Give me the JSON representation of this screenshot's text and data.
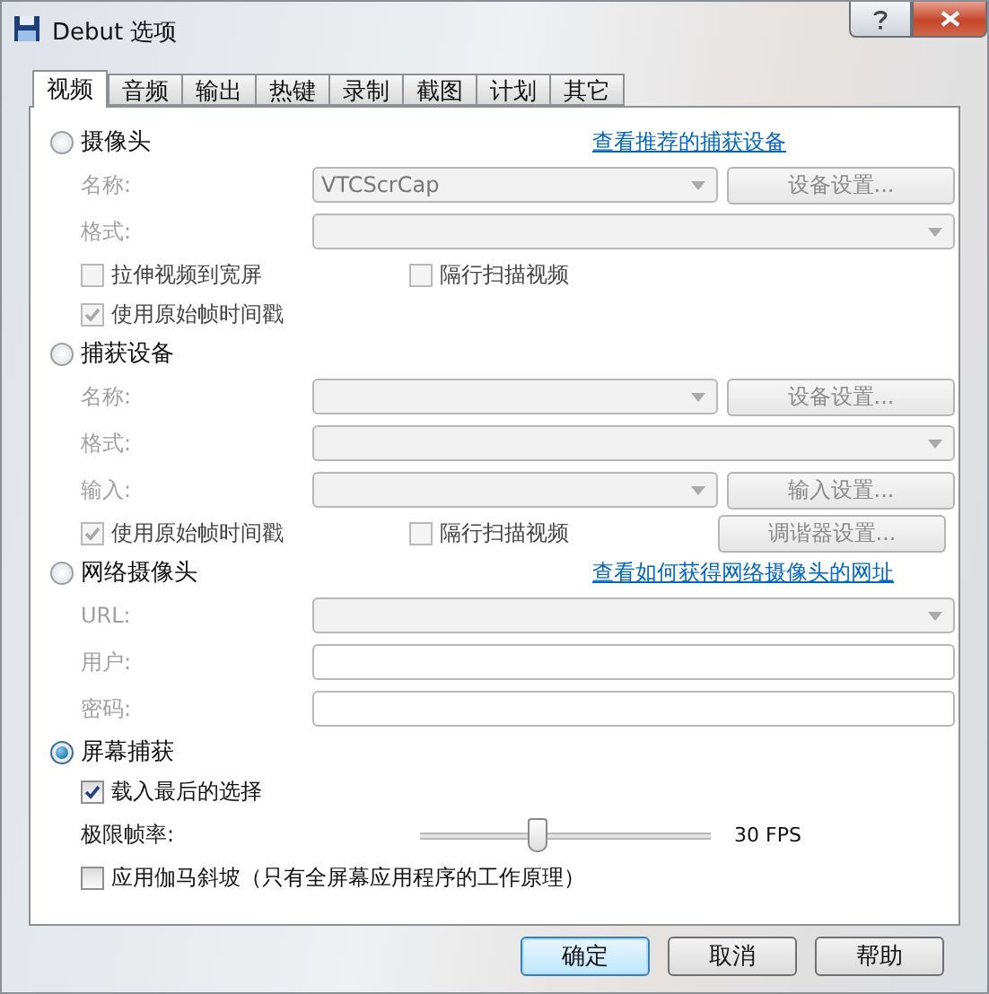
{
  "window": {
    "title": "Debut 选项"
  },
  "tabs": [
    {
      "label": "视频",
      "selected": true
    },
    {
      "label": "音频",
      "selected": false
    },
    {
      "label": "输出",
      "selected": false
    },
    {
      "label": "热键",
      "selected": false
    },
    {
      "label": "录制",
      "selected": false
    },
    {
      "label": "截图",
      "selected": false
    },
    {
      "label": "计划",
      "selected": false
    },
    {
      "label": "其它",
      "selected": false
    }
  ],
  "sections": [
    {
      "label": "摄像头",
      "selected": false,
      "link": "查看推荐的捕获设备",
      "rows": [
        {
          "kind": "select",
          "label": "名称:",
          "value": "VTCScrCap",
          "button": "设备设置..."
        },
        {
          "kind": "select",
          "label": "格式:"
        },
        {
          "kind": "checks",
          "checks": [
            {
              "label": "拉伸视频到宽屏",
              "checked": false
            },
            {
              "label": "隔行扫描视频",
              "checked": false
            }
          ]
        },
        {
          "kind": "checks",
          "checks": [
            {
              "label": "使用原始帧时间戳",
              "checked": true
            }
          ]
        }
      ]
    },
    {
      "label": "捕获设备",
      "selected": false,
      "rows": [
        {
          "kind": "select",
          "label": "名称:",
          "button": "设备设置..."
        },
        {
          "kind": "select",
          "label": "格式:"
        },
        {
          "kind": "select",
          "label": "输入:",
          "button": "输入设置..."
        },
        {
          "kind": "checks",
          "checks": [
            {
              "label": "使用原始帧时间戳",
              "checked": true
            },
            {
              "label": "隔行扫描视频",
              "checked": false
            }
          ],
          "button": "调谐器设置..."
        }
      ]
    },
    {
      "label": "网络摄像头",
      "selected": false,
      "link": "查看如何获得网络摄像头的网址",
      "rows": [
        {
          "kind": "select",
          "label": "URL:"
        },
        {
          "kind": "input",
          "label": "用户:"
        },
        {
          "kind": "input",
          "label": "密码:"
        }
      ]
    },
    {
      "label": "屏幕捕获",
      "selected": true,
      "rows": [
        {
          "kind": "checks",
          "checks": [
            {
              "label": "载入最后的选择",
              "checked": true
            }
          ]
        },
        {
          "kind": "slider",
          "label": "极限帧率:",
          "level": 0.4,
          "reading": "30 FPS"
        },
        {
          "kind": "checks",
          "checks": [
            {
              "label": "应用伽马斜坡（只有全屏幕应用程序的工作原理）",
              "checked": false
            }
          ]
        }
      ]
    }
  ],
  "buttons": [
    {
      "label": "确定",
      "default": true
    },
    {
      "label": "取消",
      "default": false
    },
    {
      "label": "帮助",
      "default": false
    }
  ]
}
